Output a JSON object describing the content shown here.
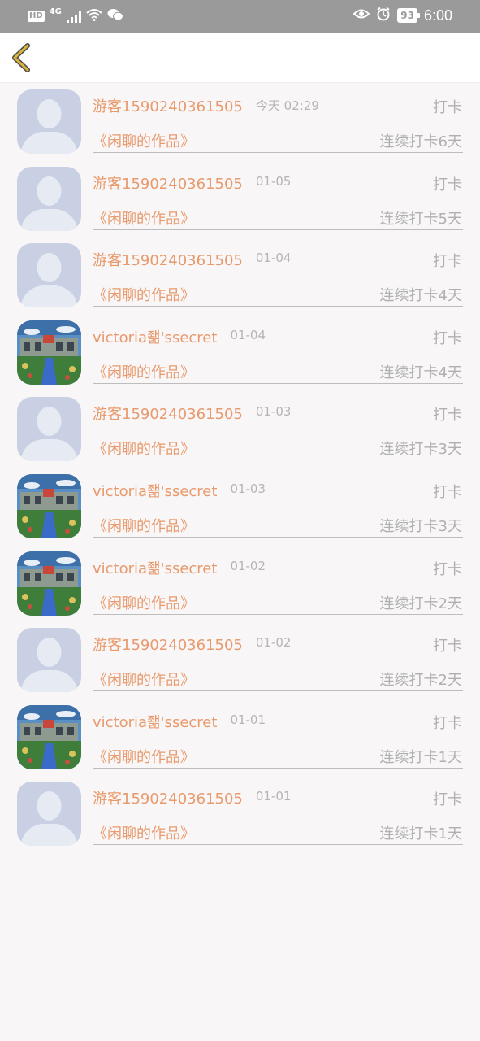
{
  "status_bar": {
    "hd": "HD",
    "network": "4G",
    "battery": "93",
    "time": "6:00"
  },
  "header": {
    "back_icon": "chevron-left-icon"
  },
  "colors": {
    "accent": "#e89a6c",
    "muted": "#b0b0b0",
    "back_icon": "#c9a531"
  },
  "records": [
    {
      "name": "游客1590240361505",
      "date": "今天 02:29",
      "action": "打卡",
      "work": "《闲聊的作品》",
      "streak": "连续打卡6天",
      "avatar": "default"
    },
    {
      "name": "游客1590240361505",
      "date": "01-05",
      "action": "打卡",
      "work": "《闲聊的作品》",
      "streak": "连续打卡5天",
      "avatar": "default"
    },
    {
      "name": "游客1590240361505",
      "date": "01-04",
      "action": "打卡",
      "work": "《闲聊的作品》",
      "streak": "连续打卡4天",
      "avatar": "default"
    },
    {
      "name": "victoria좲'ssecret",
      "date": "01-04",
      "action": "打卡",
      "work": "《闲聊的作品》",
      "streak": "连续打卡4天",
      "avatar": "photo"
    },
    {
      "name": "游客1590240361505",
      "date": "01-03",
      "action": "打卡",
      "work": "《闲聊的作品》",
      "streak": "连续打卡3天",
      "avatar": "default"
    },
    {
      "name": "victoria좲'ssecret",
      "date": "01-03",
      "action": "打卡",
      "work": "《闲聊的作品》",
      "streak": "连续打卡3天",
      "avatar": "photo"
    },
    {
      "name": "victoria좲'ssecret",
      "date": "01-02",
      "action": "打卡",
      "work": "《闲聊的作品》",
      "streak": "连续打卡2天",
      "avatar": "photo"
    },
    {
      "name": "游客1590240361505",
      "date": "01-02",
      "action": "打卡",
      "work": "《闲聊的作品》",
      "streak": "连续打卡2天",
      "avatar": "default"
    },
    {
      "name": "victoria좲'ssecret",
      "date": "01-01",
      "action": "打卡",
      "work": "《闲聊的作品》",
      "streak": "连续打卡1天",
      "avatar": "photo"
    },
    {
      "name": "游客1590240361505",
      "date": "01-01",
      "action": "打卡",
      "work": "《闲聊的作品》",
      "streak": "连续打卡1天",
      "avatar": "default"
    }
  ]
}
